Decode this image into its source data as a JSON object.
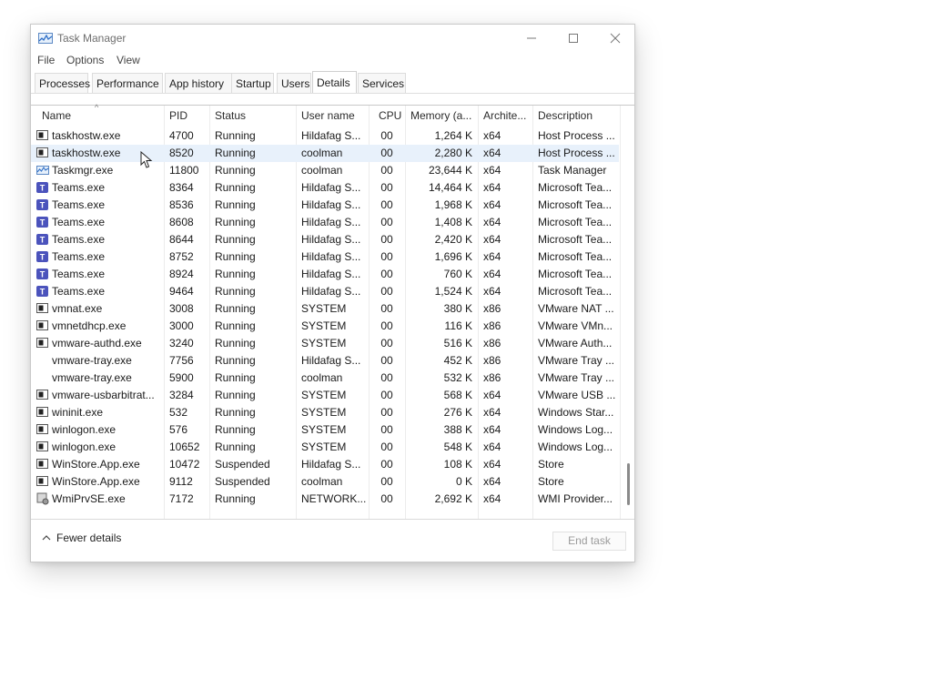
{
  "window": {
    "title": "Task Manager"
  },
  "menu": [
    "File",
    "Options",
    "View"
  ],
  "tabs": [
    "Processes",
    "Performance",
    "App history",
    "Startup",
    "Users",
    "Details",
    "Services"
  ],
  "active_tab": "Details",
  "columns": [
    "Name",
    "PID",
    "Status",
    "User name",
    "CPU",
    "Memory (a...",
    "Archite...",
    "Description"
  ],
  "rows": [
    {
      "name": "taskhostw.exe",
      "pid": "4700",
      "status": "Running",
      "user": "Hildafag S...",
      "cpu": "00",
      "memory": "1,264 K",
      "arch": "x64",
      "desc": "Host Process ...",
      "icon": "process-icon"
    },
    {
      "name": "taskhostw.exe",
      "pid": "8520",
      "status": "Running",
      "user": "coolman",
      "cpu": "00",
      "memory": "2,280 K",
      "arch": "x64",
      "desc": "Host Process ...",
      "icon": "process-icon"
    },
    {
      "name": "Taskmgr.exe",
      "pid": "11800",
      "status": "Running",
      "user": "coolman",
      "cpu": "00",
      "memory": "23,644 K",
      "arch": "x64",
      "desc": "Task Manager",
      "icon": "taskmgr-icon"
    },
    {
      "name": "Teams.exe",
      "pid": "8364",
      "status": "Running",
      "user": "Hildafag S...",
      "cpu": "00",
      "memory": "14,464 K",
      "arch": "x64",
      "desc": "Microsoft Tea...",
      "icon": "teams-icon"
    },
    {
      "name": "Teams.exe",
      "pid": "8536",
      "status": "Running",
      "user": "Hildafag S...",
      "cpu": "00",
      "memory": "1,968 K",
      "arch": "x64",
      "desc": "Microsoft Tea...",
      "icon": "teams-icon"
    },
    {
      "name": "Teams.exe",
      "pid": "8608",
      "status": "Running",
      "user": "Hildafag S...",
      "cpu": "00",
      "memory": "1,408 K",
      "arch": "x64",
      "desc": "Microsoft Tea...",
      "icon": "teams-icon"
    },
    {
      "name": "Teams.exe",
      "pid": "8644",
      "status": "Running",
      "user": "Hildafag S...",
      "cpu": "00",
      "memory": "2,420 K",
      "arch": "x64",
      "desc": "Microsoft Tea...",
      "icon": "teams-icon"
    },
    {
      "name": "Teams.exe",
      "pid": "8752",
      "status": "Running",
      "user": "Hildafag S...",
      "cpu": "00",
      "memory": "1,696 K",
      "arch": "x64",
      "desc": "Microsoft Tea...",
      "icon": "teams-icon"
    },
    {
      "name": "Teams.exe",
      "pid": "8924",
      "status": "Running",
      "user": "Hildafag S...",
      "cpu": "00",
      "memory": "760 K",
      "arch": "x64",
      "desc": "Microsoft Tea...",
      "icon": "teams-icon"
    },
    {
      "name": "Teams.exe",
      "pid": "9464",
      "status": "Running",
      "user": "Hildafag S...",
      "cpu": "00",
      "memory": "1,524 K",
      "arch": "x64",
      "desc": "Microsoft Tea...",
      "icon": "teams-icon"
    },
    {
      "name": "vmnat.exe",
      "pid": "3008",
      "status": "Running",
      "user": "SYSTEM",
      "cpu": "00",
      "memory": "380 K",
      "arch": "x86",
      "desc": "VMware NAT ...",
      "icon": "process-icon"
    },
    {
      "name": "vmnetdhcp.exe",
      "pid": "3000",
      "status": "Running",
      "user": "SYSTEM",
      "cpu": "00",
      "memory": "116 K",
      "arch": "x86",
      "desc": "VMware VMn...",
      "icon": "process-icon"
    },
    {
      "name": "vmware-authd.exe",
      "pid": "3240",
      "status": "Running",
      "user": "SYSTEM",
      "cpu": "00",
      "memory": "516 K",
      "arch": "x86",
      "desc": "VMware Auth...",
      "icon": "process-icon"
    },
    {
      "name": "vmware-tray.exe",
      "pid": "7756",
      "status": "Running",
      "user": "Hildafag S...",
      "cpu": "00",
      "memory": "452 K",
      "arch": "x86",
      "desc": "VMware Tray ...",
      "icon": ""
    },
    {
      "name": "vmware-tray.exe",
      "pid": "5900",
      "status": "Running",
      "user": "coolman",
      "cpu": "00",
      "memory": "532 K",
      "arch": "x86",
      "desc": "VMware Tray ...",
      "icon": ""
    },
    {
      "name": "vmware-usbarbitrat...",
      "pid": "3284",
      "status": "Running",
      "user": "SYSTEM",
      "cpu": "00",
      "memory": "568 K",
      "arch": "x64",
      "desc": "VMware USB ...",
      "icon": "process-icon"
    },
    {
      "name": "wininit.exe",
      "pid": "532",
      "status": "Running",
      "user": "SYSTEM",
      "cpu": "00",
      "memory": "276 K",
      "arch": "x64",
      "desc": "Windows Star...",
      "icon": "process-icon"
    },
    {
      "name": "winlogon.exe",
      "pid": "576",
      "status": "Running",
      "user": "SYSTEM",
      "cpu": "00",
      "memory": "388 K",
      "arch": "x64",
      "desc": "Windows Log...",
      "icon": "process-icon"
    },
    {
      "name": "winlogon.exe",
      "pid": "10652",
      "status": "Running",
      "user": "SYSTEM",
      "cpu": "00",
      "memory": "548 K",
      "arch": "x64",
      "desc": "Windows Log...",
      "icon": "process-icon"
    },
    {
      "name": "WinStore.App.exe",
      "pid": "10472",
      "status": "Suspended",
      "user": "Hildafag S...",
      "cpu": "00",
      "memory": "108 K",
      "arch": "x64",
      "desc": "Store",
      "icon": "process-icon"
    },
    {
      "name": "WinStore.App.exe",
      "pid": "9112",
      "status": "Suspended",
      "user": "coolman",
      "cpu": "00",
      "memory": "0 K",
      "arch": "x64",
      "desc": "Store",
      "icon": "process-icon"
    },
    {
      "name": "WmiPrvSE.exe",
      "pid": "7172",
      "status": "Running",
      "user": "NETWORK...",
      "cpu": "00",
      "memory": "2,692 K",
      "arch": "x64",
      "desc": "WMI Provider...",
      "icon": "wmi-icon"
    }
  ],
  "hovered_row": 1,
  "footer": {
    "fewer_details": "Fewer details",
    "end_task": "End task"
  },
  "colors": {
    "teams": "#4b53bc",
    "hover": "#e8f1fb",
    "accent": "#0078d4"
  }
}
